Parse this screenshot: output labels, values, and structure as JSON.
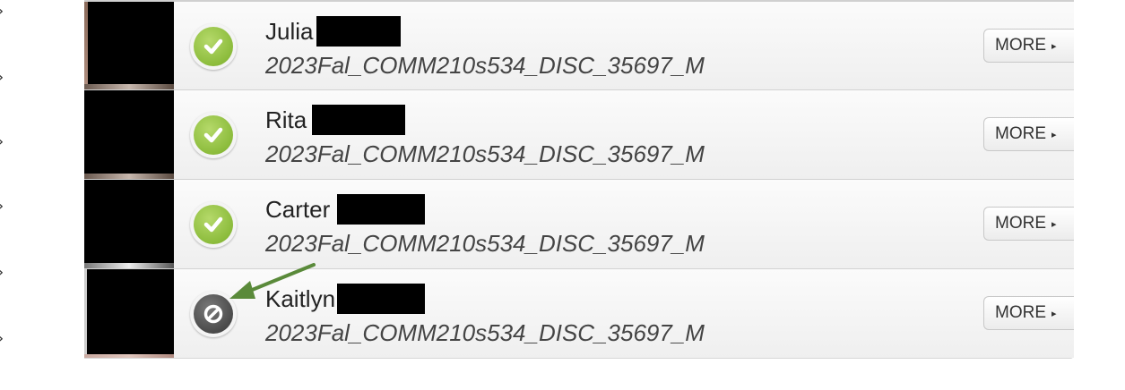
{
  "edge_chevrons": [
    "›",
    "›",
    "›",
    "›",
    "›",
    "›"
  ],
  "roster": [
    {
      "first_name": "Julia",
      "section": "2023Fal_COMM210s534_DISC_35697_M",
      "status": "present",
      "status_icon": "check-icon",
      "more_label": "MORE",
      "more_caret": "▸"
    },
    {
      "first_name": "Rita",
      "section": "2023Fal_COMM210s534_DISC_35697_M",
      "status": "present",
      "status_icon": "check-icon",
      "more_label": "MORE",
      "more_caret": "▸"
    },
    {
      "first_name": "Carter",
      "section": "2023Fal_COMM210s534_DISC_35697_M",
      "status": "present",
      "status_icon": "check-icon",
      "more_label": "MORE",
      "more_caret": "▸"
    },
    {
      "first_name": "Kaitlyn",
      "section": "2023Fal_COMM210s534_DISC_35697_M",
      "status": "absent",
      "status_icon": "prohibited-icon",
      "more_label": "MORE",
      "more_caret": "▸"
    }
  ],
  "colors": {
    "present_green": "#8cbc3c",
    "absent_gray": "#4a4a4a",
    "annotation_arrow": "#5a8a3a"
  }
}
